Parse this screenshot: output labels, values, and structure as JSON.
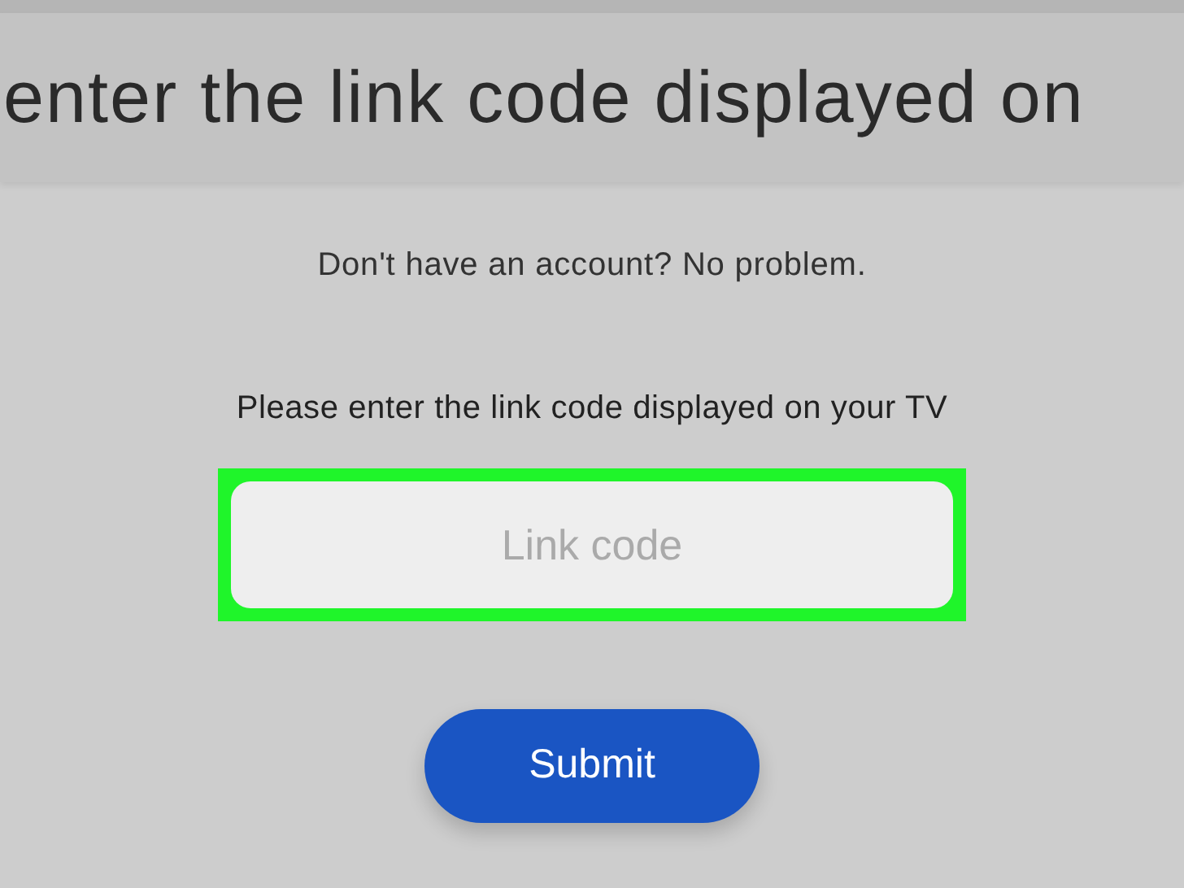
{
  "header": {
    "title": "enter the link code displayed on"
  },
  "intro": "Don't have an account? No problem.",
  "prompt": "Please enter the link code displayed on your TV",
  "link_code_field": {
    "placeholder": "Link code",
    "highlighted": true
  },
  "submit_button": {
    "label": "Submit"
  }
}
